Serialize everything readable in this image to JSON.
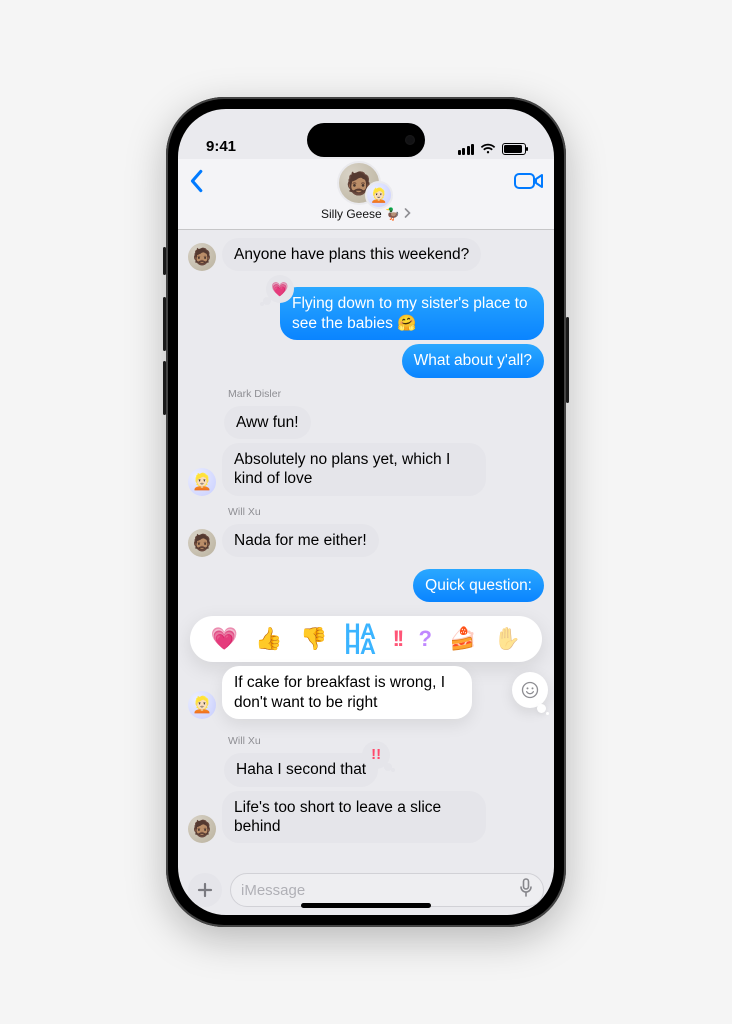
{
  "status": {
    "time": "9:41"
  },
  "header": {
    "title": "Silly Geese 🦆",
    "avatars": {
      "primary": "memoji-blue",
      "secondary": "memoji-light"
    }
  },
  "tapbacks": {
    "heart": "💗",
    "thumbs_up": "👍",
    "thumbs_down": "👎",
    "haha_line1": "HA",
    "haha_line2": "HA",
    "exclaim": "!!",
    "question": "?",
    "emoji": "🍰"
  },
  "messages": {
    "m0": {
      "text": "Anyone have plans this weekend?"
    },
    "m1": {
      "text": "Flying down to my sister's place to see the babies 🤗",
      "reaction": "💗"
    },
    "m2": {
      "text": "What about y'all?"
    },
    "m3": {
      "sender": "Mark Disler",
      "text": "Aww fun!"
    },
    "m4": {
      "text": "Absolutely no plans yet, which I kind of love"
    },
    "m5": {
      "sender": "Will Xu",
      "text": "Nada for me either!"
    },
    "m6": {
      "text": "Quick question:"
    },
    "m7": {
      "text": "If cake for breakfast is wrong, I don't want to be right"
    },
    "m8": {
      "sender": "Will Xu",
      "text": "Haha I second that",
      "reaction": "!!"
    },
    "m9": {
      "text": "Life's too short to leave a slice behind"
    }
  },
  "input": {
    "placeholder": "iMessage"
  }
}
